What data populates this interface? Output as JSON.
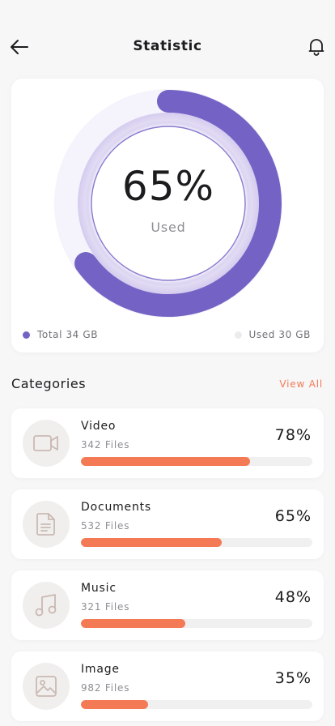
{
  "header": {
    "title": "Statistic",
    "back_icon": "arrow-left-icon",
    "notification_icon": "bell-icon"
  },
  "storage": {
    "used_percent": 65,
    "used_percent_label": "65%",
    "used_label": "Used",
    "legend_total": "Total 34 GB",
    "legend_used": "Used 30 GB"
  },
  "categories": {
    "heading": "Categories",
    "view_all": "View All",
    "items": [
      {
        "name": "Video",
        "files": "342 Files",
        "percent_label": "78%",
        "fraction": 0.73,
        "icon": "video-camera-icon"
      },
      {
        "name": "Documents",
        "files": "532 Files",
        "percent_label": "65%",
        "fraction": 0.61,
        "icon": "document-icon"
      },
      {
        "name": "Music",
        "files": "321 Files",
        "percent_label": "48%",
        "fraction": 0.45,
        "icon": "music-note-icon"
      },
      {
        "name": "Image",
        "files": "982 Files",
        "percent_label": "35%",
        "fraction": 0.29,
        "icon": "image-icon"
      }
    ]
  },
  "colors": {
    "accent_purple": "#7463c5",
    "accent_orange": "#f47a56",
    "donut_track": "#f5f3fb",
    "used_dot": "#ececef"
  }
}
